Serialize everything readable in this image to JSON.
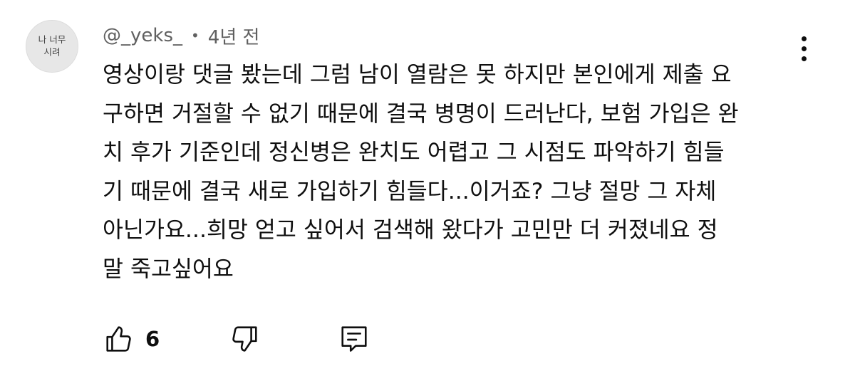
{
  "comment": {
    "author": "@_yeks_",
    "separator": "•",
    "time": "4년 전",
    "avatar_text": [
      "나 너무",
      "시려"
    ],
    "lines": [
      "영상이랑 댓글 봤는데 그럼 남이 열람은 못 하지만 본인에게 제출 요",
      "구하면 거절할 수 없기 때문에 결국 병명이 드러난다, 보험 가입은 완",
      "치 후가 기준인데 정신병은 완치도 어렵고 그 시점도 파악하기 힘들",
      "기 때문에 결국 새로 가입하기 힘들다...이거죠? 그냥 절망 그 자체",
      "아닌가요...희망 얻고 싶어서 검색해 왔다가 고민만 더 커졌네요 정",
      "말 죽고싶어요"
    ],
    "like_count": "6"
  },
  "icons": {
    "menu": "more-vert-icon",
    "like": "thumb-up-icon",
    "dislike": "thumb-down-icon",
    "reply": "reply-icon"
  }
}
